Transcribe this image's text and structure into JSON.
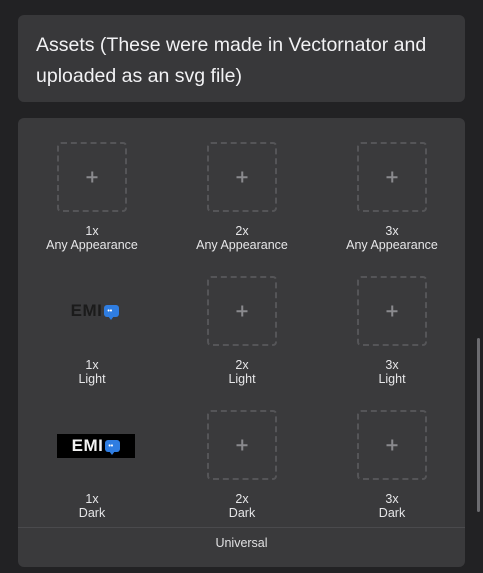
{
  "header": {
    "title": "Assets (These were made in Vectornator and uploaded as an svg file)"
  },
  "rows": [
    {
      "appearance": "Any Appearance",
      "cells": [
        {
          "scale": "1x",
          "content": "empty"
        },
        {
          "scale": "2x",
          "content": "empty"
        },
        {
          "scale": "3x",
          "content": "empty"
        }
      ]
    },
    {
      "appearance": "Light",
      "cells": [
        {
          "scale": "1x",
          "content": "logo"
        },
        {
          "scale": "2x",
          "content": "empty"
        },
        {
          "scale": "3x",
          "content": "empty"
        }
      ]
    },
    {
      "appearance": "Dark",
      "cells": [
        {
          "scale": "1x",
          "content": "logo"
        },
        {
          "scale": "2x",
          "content": "empty"
        },
        {
          "scale": "3x",
          "content": "empty"
        }
      ]
    }
  ],
  "logo": {
    "text": "EMI",
    "bubble_glyph": "••"
  },
  "footer": {
    "label": "Universal"
  },
  "icons": {
    "add": "plus-icon",
    "logo_bubble": "chat-bubble-icon"
  },
  "colors": {
    "background": "#222224",
    "card": "#38383a",
    "accent": "#2f7de1"
  }
}
